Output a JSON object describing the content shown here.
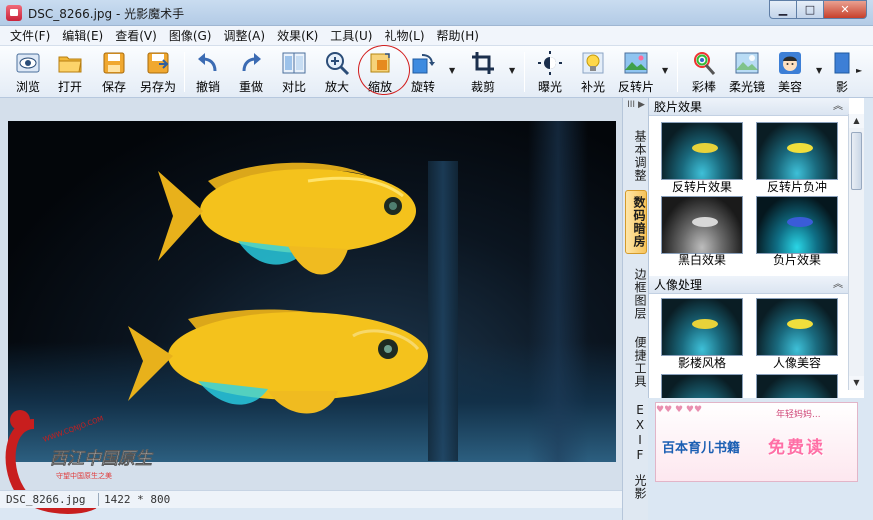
{
  "window": {
    "title": "DSC_8266.jpg - 光影魔术手",
    "controls": {
      "minimize": "▁",
      "maximize": "□",
      "close": "✕"
    }
  },
  "menu": [
    "文件(F)",
    "编辑(E)",
    "查看(V)",
    "图像(G)",
    "调整(A)",
    "效果(K)",
    "工具(U)",
    "礼物(L)",
    "帮助(H)"
  ],
  "toolbar": {
    "browse": "浏览",
    "open": "打开",
    "save": "保存",
    "save_as": "另存为",
    "undo": "撤销",
    "redo": "重做",
    "compare": "对比",
    "zoom_in": "放大",
    "resize": "缩放",
    "rotate": "旋转",
    "crop": "裁剪",
    "exposure": "曝光",
    "fill_light": "补光",
    "reversal_film": "反转片",
    "rainbow": "彩棒",
    "soft_focus": "柔光镜",
    "beauty": "美容",
    "more": "影"
  },
  "side_tabs": {
    "head": "III ▶",
    "basic_adjust": "基本调整",
    "digital_darkroom": "数码暗房",
    "border_layer": "边框图层",
    "convenient_tools": "便捷工具",
    "exif": "EXIF",
    "light": "光影"
  },
  "panel": {
    "sections": [
      {
        "title": "胶片效果",
        "items": [
          {
            "label": "反转片效果",
            "style": "invert"
          },
          {
            "label": "反转片负冲",
            "style": "invert"
          },
          {
            "label": "黑白效果",
            "style": "bw"
          },
          {
            "label": "负片效果",
            "style": "neg"
          }
        ]
      },
      {
        "title": "人像处理",
        "items": [
          {
            "label": "影楼风格",
            "style": "invert"
          },
          {
            "label": "人像美容",
            "style": "invert"
          }
        ]
      }
    ],
    "collapse_glyph": "︽"
  },
  "ad": {
    "top_text": "年轻妈妈...",
    "title": "百本育儿书籍",
    "free": "免费读"
  },
  "status": {
    "filename": "DSC_8266.jpg",
    "dimensions": "1422 * 800"
  },
  "watermark": {
    "url": "WWW.CQNJO.COM",
    "brand": "西江中国原生",
    "tagline": "守望中国原生之美"
  },
  "colors": {
    "fish_body": "#f4c21c",
    "fish_fin": "#2ad3e8",
    "highlight_circle": "#d21d1d",
    "active_tab": "#f6c35a"
  }
}
